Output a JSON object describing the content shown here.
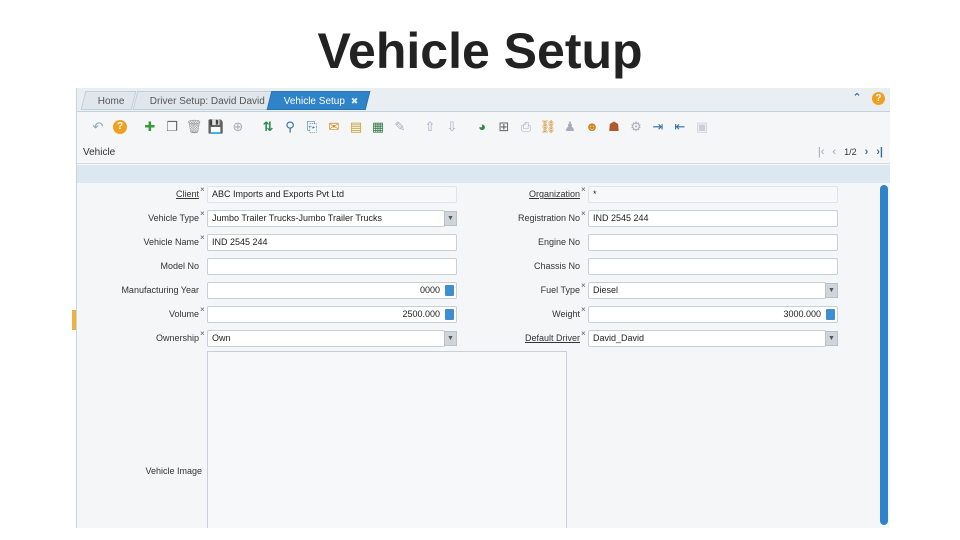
{
  "slide": {
    "title": "Vehicle Setup"
  },
  "tabs": [
    {
      "label": "Home"
    },
    {
      "label": "Driver Setup: David David",
      "close": "✖"
    },
    {
      "label": "Vehicle Setup",
      "close": "✖"
    }
  ],
  "window": {
    "title": "Vehicle",
    "page": "1/2"
  },
  "form": {
    "client": {
      "label": "Client",
      "value": "ABC Imports and Exports Pvt Ltd"
    },
    "organization": {
      "label": "Organization",
      "value": "*"
    },
    "vehicle_type": {
      "label": "Vehicle Type",
      "value": "Jumbo Trailer Trucks-Jumbo Trailer Trucks"
    },
    "registration_no": {
      "label": "Registration No",
      "value": "IND 2545 244"
    },
    "vehicle_name": {
      "label": "Vehicle Name",
      "value": "IND 2545 244"
    },
    "engine_no": {
      "label": "Engine No",
      "value": ""
    },
    "model_no": {
      "label": "Model No",
      "value": ""
    },
    "chassis_no": {
      "label": "Chassis No",
      "value": ""
    },
    "manufacturing_year": {
      "label": "Manufacturing Year",
      "value": "0000"
    },
    "fuel_type": {
      "label": "Fuel Type",
      "value": "Diesel"
    },
    "volume": {
      "label": "Volume",
      "value": "2500.000"
    },
    "weight": {
      "label": "Weight",
      "value": "3000.000"
    },
    "ownership": {
      "label": "Ownership",
      "value": "Own"
    },
    "default_driver": {
      "label": "Default Driver",
      "value": "David_David"
    },
    "vehicle_image": {
      "label": "Vehicle Image"
    }
  },
  "colors": {
    "accent": "#2f83c8",
    "help": "#f0a020"
  }
}
